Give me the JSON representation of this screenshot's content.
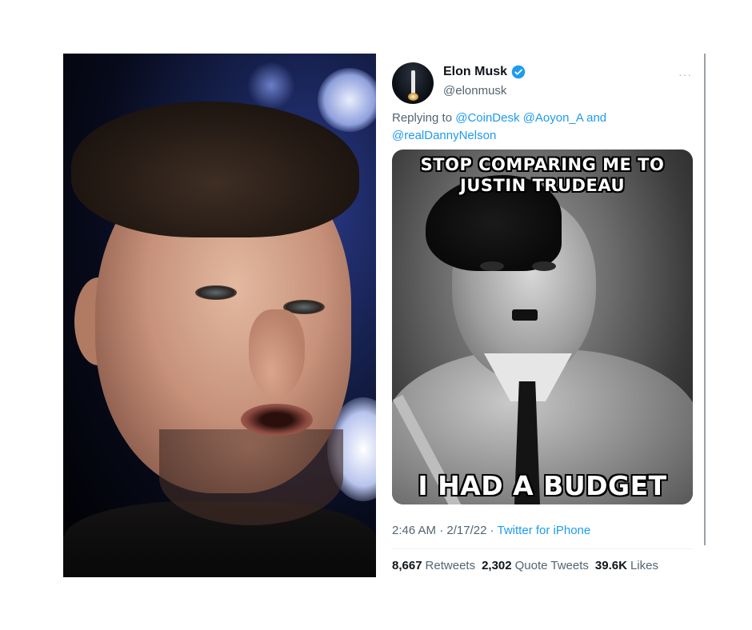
{
  "tweet": {
    "author_name": "Elon Musk",
    "handle": "@elonmusk",
    "reply_prefix": "Replying to",
    "mentions": [
      "@CoinDesk",
      "@Aoyon_A",
      "@realDannyNelson"
    ],
    "reply_joiner": "and",
    "more_icon": "···",
    "verified_color": "#1d9bf0",
    "meme": {
      "top_caption": "STOP COMPARING ME TO JUSTIN TRUDEAU",
      "bottom_caption": "I HAD A BUDGET"
    },
    "time": "2:46 AM",
    "date": "2/17/22",
    "separator": "·",
    "source_app": "Twitter for iPhone",
    "stats": [
      {
        "count": "8,667",
        "label": "Retweets"
      },
      {
        "count": "2,302",
        "label": "Quote Tweets"
      },
      {
        "count": "39.6K",
        "label": "Likes"
      }
    ]
  },
  "colors": {
    "link": "#1d9bf0",
    "secondary_text": "#536471",
    "primary_text": "#0f1419"
  }
}
